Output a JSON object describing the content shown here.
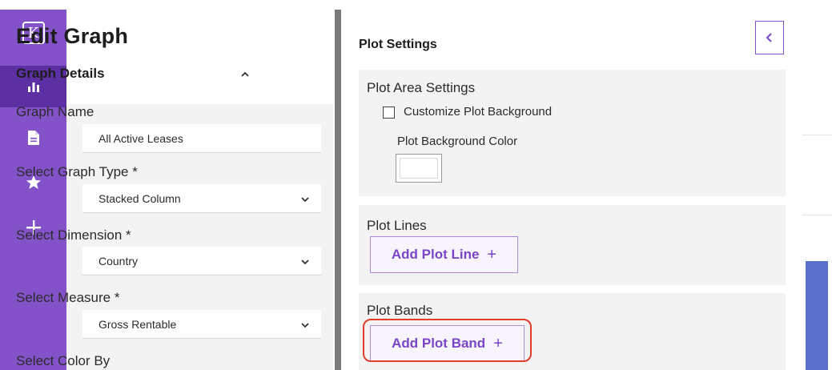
{
  "sidebar": {
    "logo_glyph": "K",
    "items": [
      {
        "name": "charts",
        "icon": "bar-chart-icon",
        "active": true
      },
      {
        "name": "documents",
        "icon": "document-icon",
        "active": false
      },
      {
        "name": "favorites",
        "icon": "star-icon",
        "active": false
      },
      {
        "name": "add",
        "icon": "plus-icon",
        "active": false
      }
    ]
  },
  "edit_panel": {
    "title": "Edit Graph",
    "section_title": "Graph Details",
    "fields": {
      "graph_name": {
        "label": "Graph Name",
        "value": "All Active Leases"
      },
      "graph_type": {
        "label": "Select Graph Type *",
        "value": "Stacked Column"
      },
      "dimension": {
        "label": "Select Dimension  *",
        "value": "Country"
      },
      "measure": {
        "label": "Select Measure  *",
        "value": "Gross Rentable"
      },
      "color_by": {
        "label": "Select Color By"
      }
    }
  },
  "plot_settings": {
    "title": "Plot Settings",
    "plot_area": {
      "title": "Plot Area Settings",
      "checkbox_label": "Customize Plot Background",
      "checked": false,
      "color_label": "Plot Background Color",
      "color_value": "#ffffff"
    },
    "plot_lines": {
      "title": "Plot Lines",
      "button_label": "Add Plot Line",
      "button_icon": "+"
    },
    "plot_bands": {
      "title": "Plot Bands",
      "button_label": "Add Plot Band",
      "button_icon": "+"
    }
  },
  "colors": {
    "sidebar": "#8352c9",
    "sidebar_active": "#5c2fa3",
    "accent": "#7a45c8",
    "highlight": "#e23d2b",
    "chart_bar": "#5a6fc9"
  }
}
